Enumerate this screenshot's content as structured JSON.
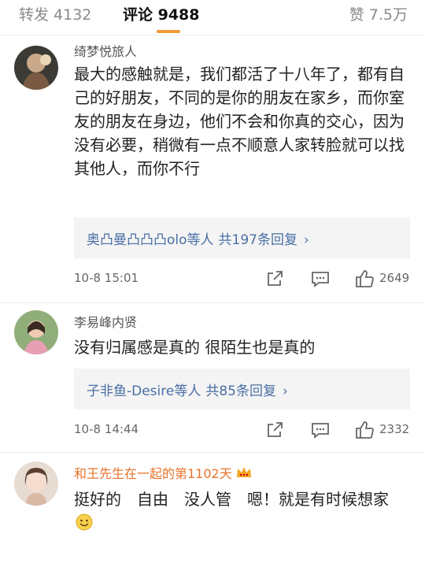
{
  "tabs": {
    "forward": "转发 4132",
    "comments": "评论 9488",
    "likes": "赞 7.5万"
  },
  "comments": [
    {
      "username": "绮梦悦旅人",
      "text": "最大的感触就是，我们都活了十八年了，都有自己的好朋友，不同的是你的朋友在家乡，而你室友的朋友在身边，他们不会和你真的交心，因为没有必要，稍微有一点不顺意人家转脸就可以找其他人，而你不行",
      "reply_users": "奥凸曼凸凸凸olo等人",
      "reply_count": "共197条回复",
      "time": "10-8 15:01",
      "likes": "2649"
    },
    {
      "username": "李易峰内贤",
      "text": "没有归属感是真的 很陌生也是真的",
      "reply_users": "子非鱼-Desire等人",
      "reply_count": "共85条回复",
      "time": "10-8 14:44",
      "likes": "2332"
    },
    {
      "username": "和王先生在一起的第1102天",
      "text": "挺好的　自由　没人管　嗯！就是有时候想家",
      "username_color": "#e8722a"
    }
  ],
  "icons": [
    "share-icon",
    "comment-icon",
    "like-icon",
    "chevron-right-icon",
    "crown-badge-icon",
    "smile-emoji-icon"
  ],
  "colors": {
    "accent_underline": "#f09a37",
    "reply_link": "#4a6fa5",
    "vip_name": "#e8722a"
  }
}
